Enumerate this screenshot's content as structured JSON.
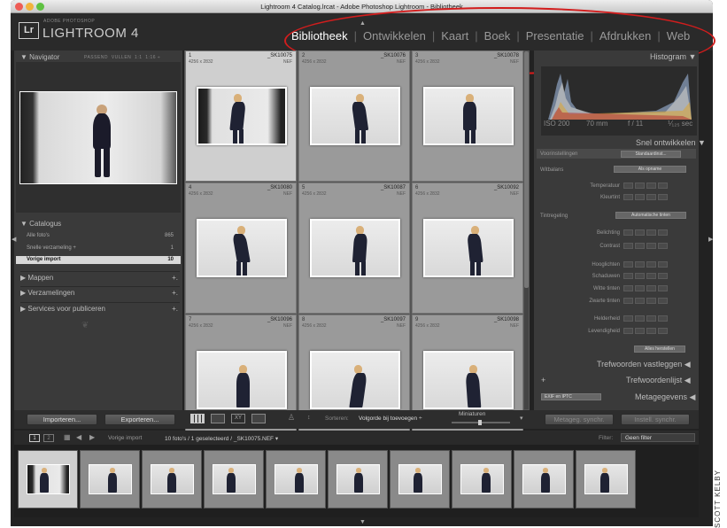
{
  "window": {
    "title": "Lightroom 4 Catalog.lrcat - Adobe Photoshop Lightroom - Bibliotheek"
  },
  "identity": {
    "adobe": "ADOBE PHOTOSHOP",
    "product": "LIGHTROOM 4",
    "badge": "Lr"
  },
  "modules": [
    {
      "label": "Bibliotheek",
      "active": true
    },
    {
      "label": "Ontwikkelen",
      "active": false
    },
    {
      "label": "Kaart",
      "active": false
    },
    {
      "label": "Boek",
      "active": false
    },
    {
      "label": "Presentatie",
      "active": false
    },
    {
      "label": "Afdrukken",
      "active": false
    },
    {
      "label": "Web",
      "active": false
    }
  ],
  "navigator": {
    "title": "Navigator",
    "options": [
      "PASSEND",
      "VULLEN",
      "1:1",
      "1:16 ÷"
    ]
  },
  "catalog": {
    "title": "Catalogus",
    "items": [
      {
        "label": "Alle foto's",
        "count": "865"
      },
      {
        "label": "Snelle verzameling +",
        "count": "1"
      },
      {
        "label": "Vorige import",
        "count": "10"
      }
    ]
  },
  "left_sections": [
    {
      "label": "Mappen",
      "plus": "+."
    },
    {
      "label": "Verzamelingen",
      "plus": "+."
    },
    {
      "label": "Services voor publiceren",
      "plus": "+."
    }
  ],
  "grid": {
    "cells": [
      {
        "num": "1",
        "name": "_SK10075",
        "dims": "4256 x 2832",
        "ext": "NEF"
      },
      {
        "num": "2",
        "name": "_SK10076",
        "dims": "4256 x 2832",
        "ext": "NEF"
      },
      {
        "num": "3",
        "name": "_SK10078",
        "dims": "4256 x 2832",
        "ext": "NEF"
      },
      {
        "num": "4",
        "name": "_SK10080",
        "dims": "4256 x 2832",
        "ext": "NEF"
      },
      {
        "num": "5",
        "name": "_SK10087",
        "dims": "4256 x 2832",
        "ext": "NEF"
      },
      {
        "num": "6",
        "name": "_SK10092",
        "dims": "4256 x 2832",
        "ext": "NEF"
      },
      {
        "num": "7",
        "name": "_SK10096",
        "dims": "4256 x 2832",
        "ext": "NEF"
      },
      {
        "num": "8",
        "name": "_SK10097",
        "dims": "4256 x 2832",
        "ext": "NEF"
      },
      {
        "num": "9",
        "name": "_SK10098",
        "dims": "4256 x 2832",
        "ext": "NEF"
      }
    ]
  },
  "histogram": {
    "title": "Histogram",
    "iso": "ISO 200",
    "focal": "70 mm",
    "aperture": "f / 11",
    "shutter": "⅟₁₂₅ sec"
  },
  "quick_develop": {
    "title": "Snel ontwikkelen",
    "presets_label": "Voorinstellingen",
    "presets_value": "Standaardinst...",
    "wb_label": "Witbalans",
    "wb_value": "Als opname",
    "temperature": "Temperatuur",
    "tint": "Kleurtint",
    "tone_label": "Tintregeling",
    "auto_tone": "Automatische tinten",
    "exposure": "Belichting",
    "contrast": "Contrast",
    "highlights": "Hooglichten",
    "shadows": "Schaduwen",
    "whites": "Witte tinten",
    "blacks": "Zwarte tinten",
    "clarity": "Helderheid",
    "vibrance": "Levendigheid",
    "reset": "Alles herstellen"
  },
  "keywording": {
    "title": "Trefwoorden vastleggen"
  },
  "keyword_list": {
    "title": "Trefwoordenlijst",
    "plus": "+"
  },
  "metadata": {
    "title": "Metagegevens",
    "preset": "EXIF en IPTC"
  },
  "toolbar": {
    "import": "Importeren...",
    "export": "Exporteren...",
    "sort_label": "Sorteren:",
    "sort_value": "Volgorde bij toevoegen ÷",
    "thumbs": "Miniaturen",
    "sync_meta": "Metageg. synchr.",
    "sync_settings": "Instell. synchr."
  },
  "filmbar": {
    "screen1": "1",
    "screen2": "2",
    "source": "Vorige import",
    "selection": "10 foto's / 1 geselecteerd / _SK10075.NEF ▾",
    "filter_label": "Filter:",
    "filter_value": "Geen filter"
  },
  "credit": "SCOTT KELBY"
}
